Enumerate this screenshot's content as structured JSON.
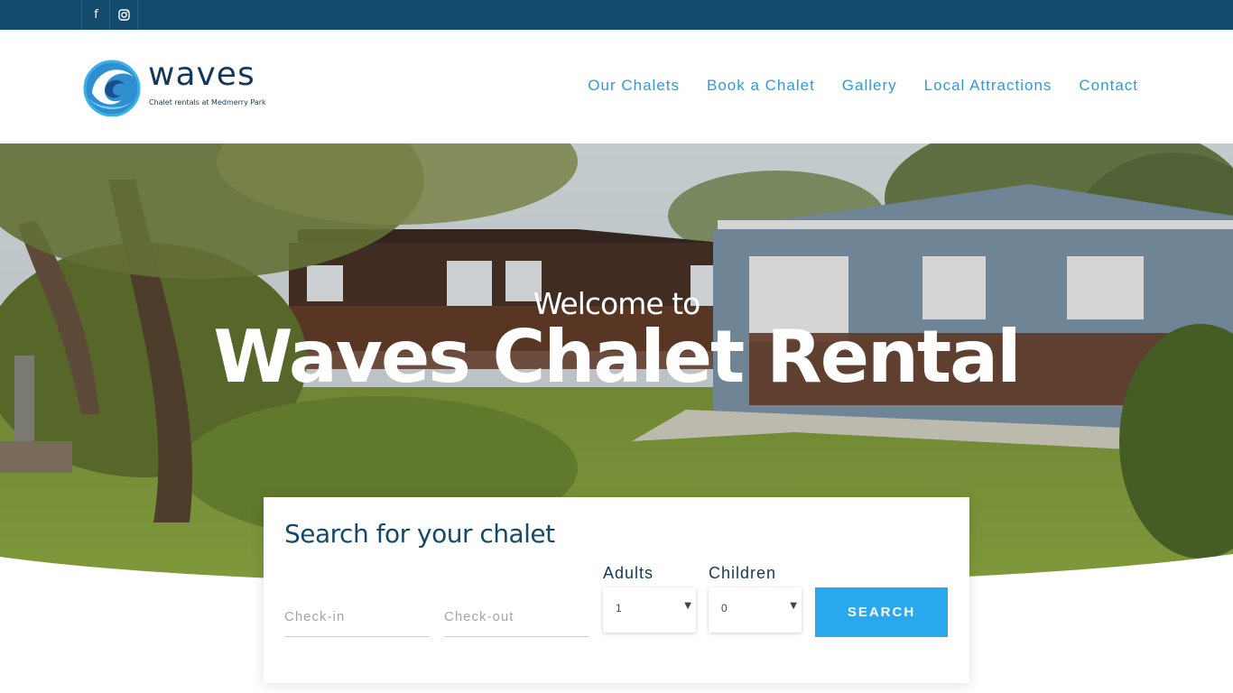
{
  "topbar": {
    "social": [
      {
        "name": "facebook-icon",
        "glyph": "f"
      },
      {
        "name": "instagram-icon",
        "glyph": "◎"
      }
    ]
  },
  "logo": {
    "word": "waves",
    "tagline": "Chalet rentals at Medmerry Park",
    "colors": {
      "wave_dark": "#1a4f8a",
      "wave_light": "#3bb0e8",
      "text": "#14385a"
    }
  },
  "nav": {
    "items": [
      "Our Chalets",
      "Book a Chalet",
      "Gallery",
      "Local Attractions",
      "Contact"
    ]
  },
  "hero": {
    "welcome": "Welcome to",
    "title": "Waves Chalet Rental"
  },
  "search": {
    "title": "Search for your chalet",
    "checkin_placeholder": "Check-in",
    "checkout_placeholder": "Check-out",
    "adults_label": "Adults",
    "adults_value": "1",
    "children_label": "Children",
    "children_value": "0",
    "button_label": "SEARCH"
  },
  "colors": {
    "topbar": "#134b6c",
    "nav_link": "#2b9bdc",
    "accent": "#2aa8ee",
    "heading": "#14496c"
  }
}
